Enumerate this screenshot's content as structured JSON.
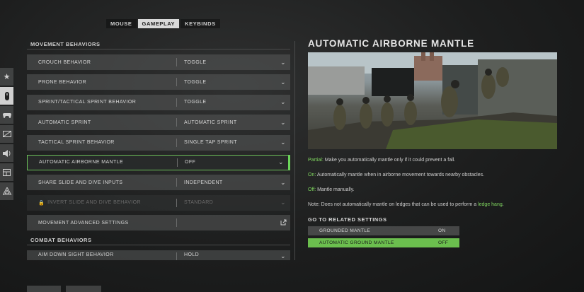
{
  "tabs": [
    {
      "label": "MOUSE",
      "active": false
    },
    {
      "label": "GAMEPLAY",
      "active": true
    },
    {
      "label": "KEYBINDS",
      "active": false
    }
  ],
  "sidebar": [
    {
      "icon": "star-icon",
      "glyph": "★"
    },
    {
      "icon": "controller-icon",
      "glyph": "▮",
      "active": true
    },
    {
      "icon": "gamepad-icon",
      "glyph": "🎮"
    },
    {
      "icon": "display-icon",
      "glyph": "◩"
    },
    {
      "icon": "speaker-icon",
      "glyph": "🔊"
    },
    {
      "icon": "interface-icon",
      "glyph": "▤"
    },
    {
      "icon": "network-icon",
      "glyph": "◬"
    }
  ],
  "sections": {
    "movement": "MOVEMENT BEHAVIORS",
    "combat": "COMBAT BEHAVIORS"
  },
  "settings": [
    {
      "label": "CROUCH BEHAVIOR",
      "value": "TOGGLE"
    },
    {
      "label": "PRONE BEHAVIOR",
      "value": "TOGGLE"
    },
    {
      "label": "SPRINT/TACTICAL SPRINT BEHAVIOR",
      "value": "TOGGLE"
    },
    {
      "label": "AUTOMATIC SPRINT",
      "value": "AUTOMATIC SPRINT"
    },
    {
      "label": "TACTICAL SPRINT BEHAVIOR",
      "value": "SINGLE TAP SPRINT"
    },
    {
      "label": "AUTOMATIC AIRBORNE MANTLE",
      "value": "OFF"
    },
    {
      "label": "SHARE SLIDE AND DIVE INPUTS",
      "value": "INDEPENDENT"
    },
    {
      "label": "INVERT SLIDE AND DIVE BEHAVIOR",
      "value": "STANDARD"
    },
    {
      "label": "MOVEMENT ADVANCED SETTINGS",
      "value": ""
    }
  ],
  "combat_settings": [
    {
      "label": "AIM DOWN SIGHT BEHAVIOR",
      "value": "HOLD"
    }
  ],
  "detail": {
    "title": "AUTOMATIC AIRBORNE MANTLE",
    "partial_label": "Partial:",
    "partial_text": " Make you automatically mantle only if it could prevent a fall.",
    "on_label": "On:",
    "on_text": " Automatically mantle when in airborne movement towards nearby obstacles.",
    "off_label": "Off:",
    "off_text": " Mantle manually.",
    "note_text": "Note: Does not automatically mantle on ledges that can be used to perform a ",
    "note_link": "ledge hang",
    "note_end": ".",
    "related_title": "GO TO RELATED SETTINGS",
    "related": [
      {
        "label": "GROUNDED MANTLE",
        "value": "ON"
      },
      {
        "label": "AUTOMATIC GROUND MANTLE",
        "value": "OFF"
      }
    ]
  },
  "colors": {
    "accent": "#6bd65a",
    "highlight_text": "#7fd65f"
  }
}
